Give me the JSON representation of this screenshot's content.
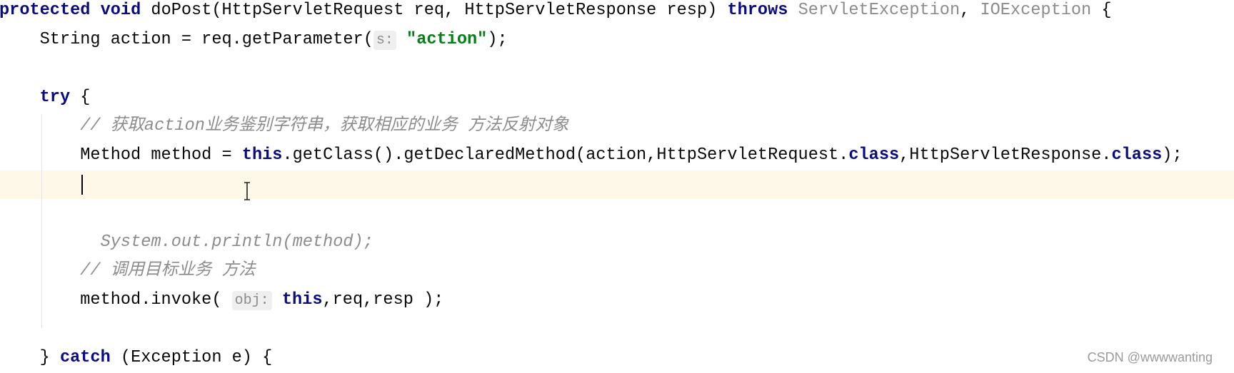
{
  "editor": {
    "lines": [
      {
        "row": 0,
        "indent": 0,
        "tokens": [
          {
            "t": "protected",
            "k": "kw"
          },
          {
            "t": " "
          },
          {
            "t": "void",
            "k": "kw"
          },
          {
            "t": " doPost(HttpServletRequest req, HttpServletResponse resp) "
          },
          {
            "t": "throws",
            "k": "kw"
          },
          {
            "t": " "
          },
          {
            "t": "ServletException",
            "k": "dim"
          },
          {
            "t": ", "
          },
          {
            "t": "IOException",
            "k": "dim"
          },
          {
            "t": " {"
          }
        ]
      },
      {
        "row": 1,
        "indent": 4,
        "tokens": [
          {
            "t": "String action = req.getParameter("
          },
          {
            "t": "s:",
            "k": "hint"
          },
          {
            "t": " "
          },
          {
            "t": "\"action\"",
            "k": "str"
          },
          {
            "t": ");"
          }
        ]
      },
      {
        "row": 3,
        "indent": 4,
        "tokens": [
          {
            "t": "try",
            "k": "kw"
          },
          {
            "t": " {"
          }
        ]
      },
      {
        "row": 4,
        "indent": 8,
        "tokens": [
          {
            "t": "// 获取action业务鉴别字符串，获取相应的业务 方法反射对象",
            "k": "cmt"
          }
        ]
      },
      {
        "row": 5,
        "indent": 8,
        "tokens": [
          {
            "t": "Method method = "
          },
          {
            "t": "this",
            "k": "kw"
          },
          {
            "t": ".getClass().getDeclaredMethod(action,HttpServletRequest."
          },
          {
            "t": "class",
            "k": "kw"
          },
          {
            "t": ",HttpServletResponse."
          },
          {
            "t": "class",
            "k": "kw"
          },
          {
            "t": ");"
          }
        ]
      },
      {
        "row": 8,
        "indent": 10,
        "tokens": [
          {
            "t": "System.out.println(method);",
            "k": "cmt"
          }
        ]
      },
      {
        "row": 9,
        "indent": 8,
        "tokens": [
          {
            "t": "// 调用目标业务 方法",
            "k": "cmt"
          }
        ]
      },
      {
        "row": 10,
        "indent": 8,
        "tokens": [
          {
            "t": "method.invoke( "
          },
          {
            "t": "obj:",
            "k": "hint"
          },
          {
            "t": " "
          },
          {
            "t": "this",
            "k": "kw"
          },
          {
            "t": ",req,resp );"
          }
        ]
      },
      {
        "row": 12,
        "indent": 4,
        "tokens": [
          {
            "t": "} "
          },
          {
            "t": "catch",
            "k": "kw"
          },
          {
            "t": " (Exception e) {"
          }
        ]
      }
    ],
    "caret_row": 6
  },
  "watermark": "CSDN @wwwwanting",
  "colors": {
    "keyword": "#0b0b80",
    "string": "#067d17",
    "comment": "#8c8c8c",
    "caret_line": "#fdf8e7"
  }
}
